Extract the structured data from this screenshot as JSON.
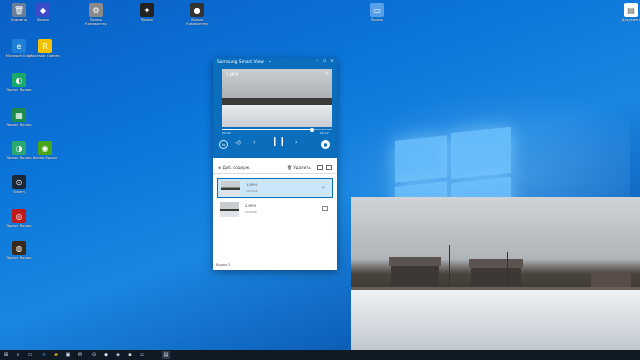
{
  "desktop": {
    "icons": [
      {
        "label": "Корзина",
        "icon": "recycle-bin-icon",
        "color": "#6a7f9a",
        "glyph": "🗑"
      },
      {
        "label": "Ярлык",
        "icon": "app-shortcut-icon",
        "color": "#3a4cc8",
        "glyph": "◆"
      },
      {
        "label": "Ярлык\nКомпьютер",
        "icon": "gear-icon",
        "color": "#8a8a8a",
        "glyph": "⚙"
      },
      {
        "label": "Ярлык",
        "icon": "app-icon",
        "color": "#222",
        "glyph": "✦"
      },
      {
        "label": "Ярлык\nКомпьютер",
        "icon": "webcam-icon",
        "color": "#333",
        "glyph": "●"
      },
      {
        "label": "Ярлык",
        "icon": "computer-icon",
        "color": "#5aa0e8",
        "glyph": "▭"
      },
      {
        "label": "Документ",
        "icon": "document-icon",
        "color": "#ffffff",
        "glyph": "▤"
      },
      {
        "label": "Microsoft Edge",
        "icon": "edge-icon",
        "color": "#1e7fd6",
        "glyph": "e"
      },
      {
        "label": "Rockstar Games",
        "icon": "rockstar-icon",
        "color": "#f2c200",
        "glyph": "R"
      },
      {
        "label": "Ярлык Ярлык",
        "icon": "app-green-icon",
        "color": "#1ba96a",
        "glyph": "◐"
      },
      {
        "label": "Ярлык Ярлык",
        "icon": "spreadsheet-icon",
        "color": "#1d8a4e",
        "glyph": "▦"
      },
      {
        "label": "Ярлык Ярлык",
        "icon": "app-green2-icon",
        "color": "#2aa86f",
        "glyph": "◑"
      },
      {
        "label": "Nvidia Ярлык",
        "icon": "nvidia-icon",
        "color": "#4aa51c",
        "glyph": "◉"
      },
      {
        "label": "Steam",
        "icon": "steam-icon",
        "color": "#1b2838",
        "glyph": "⊙"
      },
      {
        "label": "Ярлык Ярлык",
        "icon": "red-app-icon",
        "color": "#c01b1b",
        "glyph": "◎"
      },
      {
        "label": "Ярлык Ярлык",
        "icon": "dark-app-icon",
        "color": "#3a2a1a",
        "glyph": "◍"
      }
    ]
  },
  "smartview": {
    "title": "Samsung Smart View",
    "video_filename": "1.MP4",
    "time_current": "00:00",
    "time_total": "00:12",
    "progress": 0.82,
    "toolbar": {
      "add_label": "Доб. содерж.",
      "delete_label": "Удалить"
    },
    "items": [
      {
        "name": "1.MP4",
        "size": "3693КБ",
        "selected": true
      },
      {
        "name": "2.MP4",
        "size": "5683КБ",
        "selected": false
      }
    ],
    "status": "Видео 2"
  },
  "colors": {
    "accent": "#0a6ebd",
    "taskbar": "#101a24"
  }
}
